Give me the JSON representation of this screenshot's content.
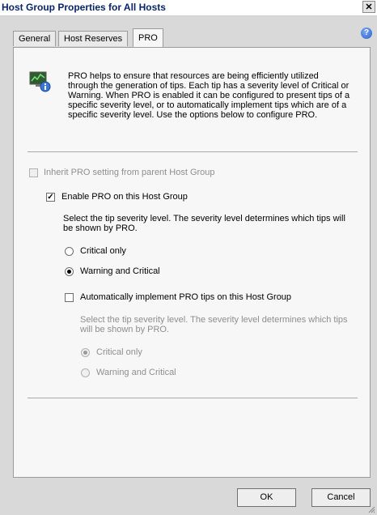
{
  "window": {
    "title": "Host Group Properties for All Hosts",
    "close_glyph": "✕",
    "help_glyph": "?"
  },
  "tabs": [
    {
      "label": "General"
    },
    {
      "label": "Host Reserves"
    },
    {
      "label": "PRO",
      "active": true
    }
  ],
  "intro": {
    "icon": "pro-monitor-info-icon",
    "text": "PRO helps to ensure that resources are being efficiently utilized through the generation of tips. Each tip has a severity level of Critical or Warning. When PRO is enabled it can be configured to present tips of a specific severity level, or to automatically implement tips which are of a specific severity level. Use the options below to configure PRO."
  },
  "inherit": {
    "label": "Inherit PRO setting from parent Host Group",
    "checked": false,
    "enabled": false
  },
  "enable_pro": {
    "label": "Enable PRO on this Host Group",
    "checked": true,
    "description": "Select the tip severity level. The severity level determines which tips will be shown by PRO.",
    "options": [
      {
        "label": "Critical only",
        "checked": false
      },
      {
        "label": "Warning and Critical",
        "checked": true
      }
    ]
  },
  "auto_implement": {
    "label": "Automatically implement PRO tips on this Host Group",
    "checked": false,
    "description": "Select the tip severity level. The severity level determines which tips will be shown by PRO.",
    "options": [
      {
        "label": "Critical only",
        "checked": true
      },
      {
        "label": "Warning and Critical",
        "checked": false
      }
    ]
  },
  "buttons": {
    "ok": "OK",
    "cancel": "Cancel"
  },
  "colors": {
    "title_text": "#0a246a",
    "panel": "#f7f7f7",
    "dialog": "#d9d9d9",
    "disabled_text": "#8e8e8e"
  }
}
